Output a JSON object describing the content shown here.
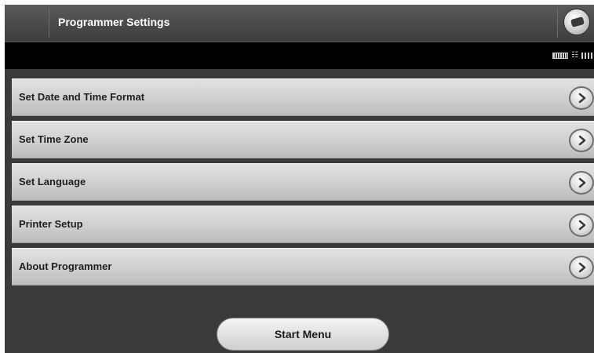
{
  "header": {
    "title": "Programmer Settings",
    "icon": "telemetry-wand-icon"
  },
  "status": {
    "icons": [
      "battery-icon",
      "wireless-signal-icon",
      "signal-strength-icon"
    ]
  },
  "menu": {
    "items": [
      {
        "label": "Set Date and Time Format",
        "icon": "chevron-right-icon"
      },
      {
        "label": "Set Time Zone",
        "icon": "chevron-right-icon"
      },
      {
        "label": "Set Language",
        "icon": "chevron-right-icon"
      },
      {
        "label": "Printer Setup",
        "icon": "chevron-right-icon"
      },
      {
        "label": "About Programmer",
        "icon": "chevron-right-icon"
      }
    ]
  },
  "footer": {
    "start_menu_label": "Start Menu"
  }
}
